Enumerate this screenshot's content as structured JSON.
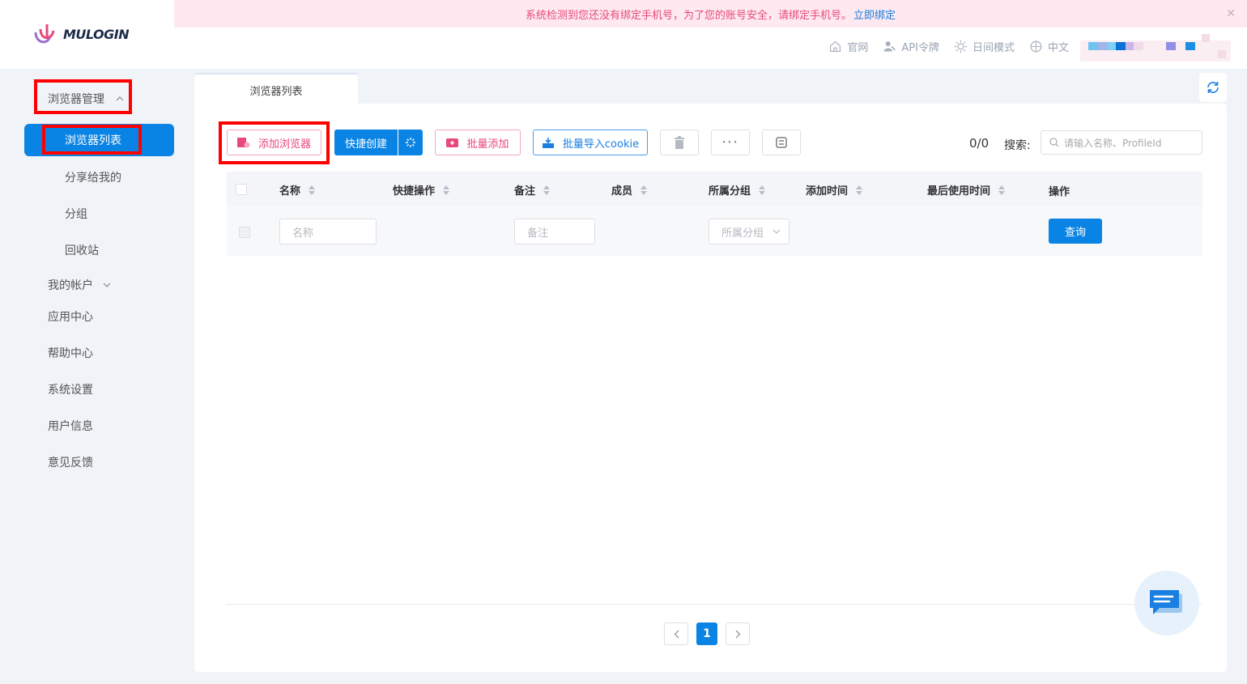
{
  "brand": {
    "name": "MULOGIN"
  },
  "notice": {
    "text": "系统检测到您还没有绑定手机号，为了您的账号安全，请绑定手机号。",
    "link": "立即绑定"
  },
  "top_links": [
    {
      "label": "官网",
      "icon": "home-icon"
    },
    {
      "label": "API令牌",
      "icon": "key-user-icon"
    },
    {
      "label": "日间模式",
      "icon": "sun-icon"
    },
    {
      "label": "中文",
      "icon": "globe-icon"
    }
  ],
  "sidebar": {
    "group_browser": "浏览器管理",
    "active_item": "浏览器列表",
    "sub_items": [
      "分享给我的",
      "分组",
      "回收站"
    ],
    "my_account": "我的帐户",
    "items": [
      "应用中心",
      "帮助中心",
      "系统设置",
      "用户信息",
      "意见反馈"
    ]
  },
  "tab": {
    "label": "浏览器列表"
  },
  "toolbar": {
    "add_browser": "添加浏览器",
    "quick_create": "快捷创建",
    "batch_add": "批量添加",
    "batch_import_cookie": "批量导入cookie"
  },
  "count": "0/0",
  "search": {
    "label": "搜索:",
    "placeholder": "请输入名称、ProfileId"
  },
  "table": {
    "columns": [
      "名称",
      "快捷操作",
      "备注",
      "成员",
      "所属分组",
      "添加时间",
      "最后使用时间",
      "操作"
    ]
  },
  "filters": {
    "name_placeholder": "名称",
    "remark_placeholder": "备注",
    "group_placeholder": "所属分组",
    "query_button": "查询"
  },
  "pagination": {
    "current": "1"
  },
  "colors": {
    "primary": "#0a84e4",
    "pink": "#e8497a",
    "highlight": "#ff0000"
  }
}
